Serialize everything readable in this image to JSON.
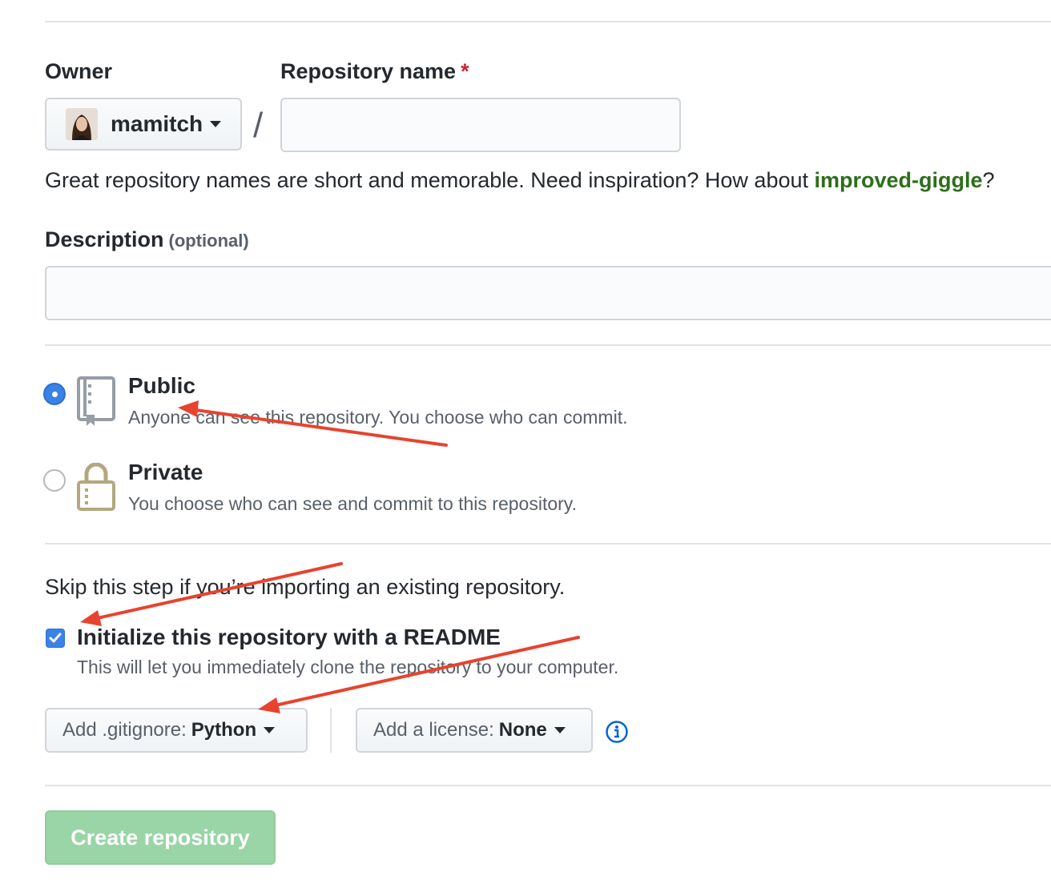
{
  "owner": {
    "label": "Owner",
    "username": "mamitch"
  },
  "repo_name": {
    "label": "Repository name",
    "required_mark": "*",
    "slash": "/",
    "value": ""
  },
  "hint": {
    "text": "Great repository names are short and memorable. Need inspiration? How about ",
    "suggestion": "improved-giggle",
    "suffix": "?"
  },
  "description": {
    "label": "Description",
    "optional": "(optional)",
    "value": ""
  },
  "visibility": {
    "selected": "public",
    "public": {
      "title": "Public",
      "description": "Anyone can see this repository. You choose who can commit."
    },
    "private": {
      "title": "Private",
      "description": "You choose who can see and commit to this repository."
    }
  },
  "init": {
    "skip_text": "Skip this step if you’re importing an existing repository.",
    "readme_label": "Initialize this repository with a README",
    "readme_desc": "This will let you immediately clone the repository to your computer.",
    "readme_checked": true
  },
  "gitignore": {
    "prefix": "Add .gitignore:",
    "value": "Python"
  },
  "license": {
    "prefix": "Add a license:",
    "value": "None"
  },
  "create_button": "Create repository",
  "colors": {
    "accent_blue": "#3b82e6",
    "suggestion_green": "#2c6e1b",
    "create_green": "#94d3a2",
    "annotation_red": "#e8432e",
    "required_red": "#cb2431"
  }
}
